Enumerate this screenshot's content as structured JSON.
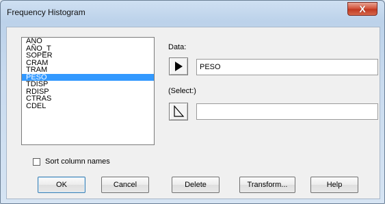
{
  "window": {
    "title": "Frequency Histogram",
    "close_glyph": "X"
  },
  "columns_list": {
    "items": [
      "AÑO",
      "AÑO_T",
      "SOPER",
      "CRAM",
      "TRAM",
      "PESO",
      "TDISP",
      "RDISP",
      "CTRAS",
      "CDEL"
    ],
    "selected": "PESO"
  },
  "data_field": {
    "label": "Data:",
    "value": "PESO"
  },
  "select_field": {
    "label": "(Select:)",
    "value": ""
  },
  "sort_option": {
    "label": "Sort column names",
    "checked": false
  },
  "buttons": {
    "ok": "OK",
    "cancel": "Cancel",
    "delete": "Delete",
    "transform": "Transform...",
    "help": "Help"
  },
  "colors": {
    "selection": "#3399ff",
    "close_button": "#c13a22"
  },
  "icons": {
    "data_arrow": "play-arrow-icon",
    "select_arrow": "outline-arrow-icon"
  }
}
